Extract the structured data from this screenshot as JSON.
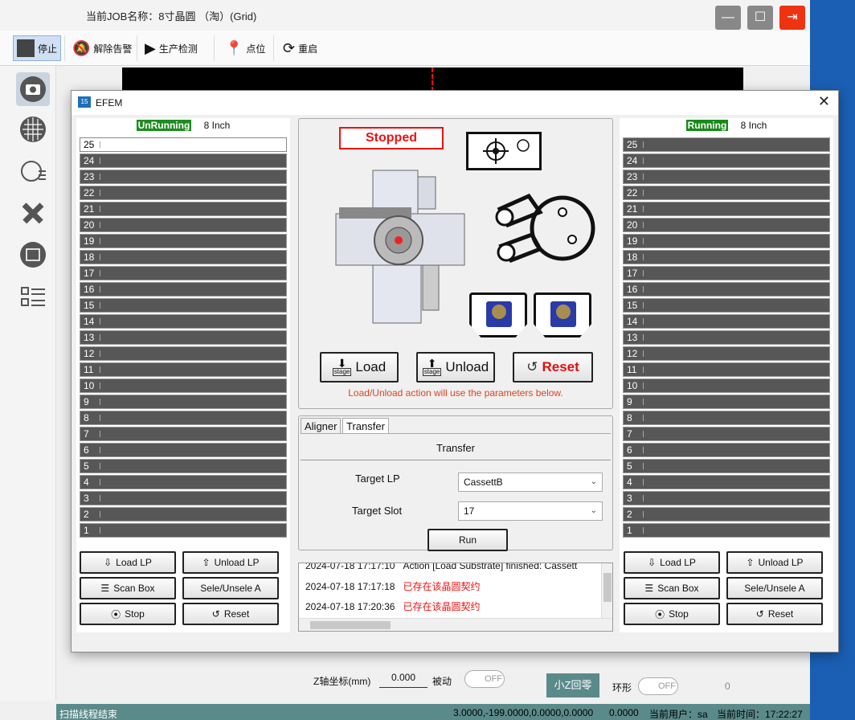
{
  "main": {
    "job_title": "当前JOB名称：8寸晶圆 （淘）(Grid)",
    "toolbar": {
      "stop": "停止",
      "clear_alarm": "解除告警",
      "production": "生产检测",
      "point": "点位",
      "restart": "重启"
    },
    "status": {
      "msg": "扫描线程结束",
      "coords": "3.0000,-199.0000,0.0000,0.0000",
      "value": "0.0000",
      "user": "当前用户：sa",
      "time": "当前时间：17:22:27"
    },
    "bottom": {
      "z_label": "Z轴坐标(mm)",
      "z_value": "0.000",
      "passive": "被动",
      "off1": "OFF",
      "small_z": "小Z回零",
      "ring": "环形",
      "off2": "OFF",
      "zero": "0"
    }
  },
  "dialog": {
    "title": "EFEM",
    "left": {
      "status": "UnRunning",
      "size": "8 Inch",
      "slots": [
        "25",
        "24",
        "23",
        "22",
        "21",
        "20",
        "19",
        "18",
        "17",
        "16",
        "15",
        "14",
        "13",
        "12",
        "11",
        "10",
        "9",
        "8",
        "7",
        "6",
        "5",
        "4",
        "3",
        "2",
        "1"
      ],
      "empty_slots": [
        "25"
      ],
      "load_lp": "Load LP",
      "unload_lp": "Unload LP",
      "scan_box": "Scan Box",
      "sele": "Sele/Unsele A",
      "stop": "Stop",
      "reset": "Reset"
    },
    "right": {
      "status": "Running",
      "size": "8 Inch",
      "slots": [
        "25",
        "24",
        "23",
        "22",
        "21",
        "20",
        "19",
        "18",
        "17",
        "16",
        "15",
        "14",
        "13",
        "12",
        "11",
        "10",
        "9",
        "8",
        "7",
        "6",
        "5",
        "4",
        "3",
        "2",
        "1"
      ],
      "empty_slots": [],
      "load_lp": "Load LP",
      "unload_lp": "Unload LP",
      "scan_box": "Scan Box",
      "sele": "Sele/Unsele A",
      "stop": "Stop",
      "reset": "Reset"
    },
    "center": {
      "state": "Stopped",
      "load": "Load",
      "unload": "Unload",
      "reset": "Reset",
      "stage_tag": "stage",
      "hint": "Load/Unload action will use the parameters below.",
      "tabs": [
        "Aligner",
        "Transfer"
      ],
      "active_tab": "Transfer",
      "section_title": "Transfer",
      "target_lp_label": "Target LP",
      "target_lp_value": "CassettB",
      "target_slot_label": "Target Slot",
      "target_slot_value": "17",
      "run": "Run"
    },
    "log": [
      {
        "time": "2024-07-18 17:17:10",
        "msg": "Action [Load Substrate] finished: Cassett",
        "error": false
      },
      {
        "time": "2024-07-18 17:17:18",
        "msg": "已存在该晶圆契约",
        "error": true
      },
      {
        "time": "2024-07-18 17:20:36",
        "msg": "已存在该晶圆契约",
        "error": true
      }
    ]
  }
}
